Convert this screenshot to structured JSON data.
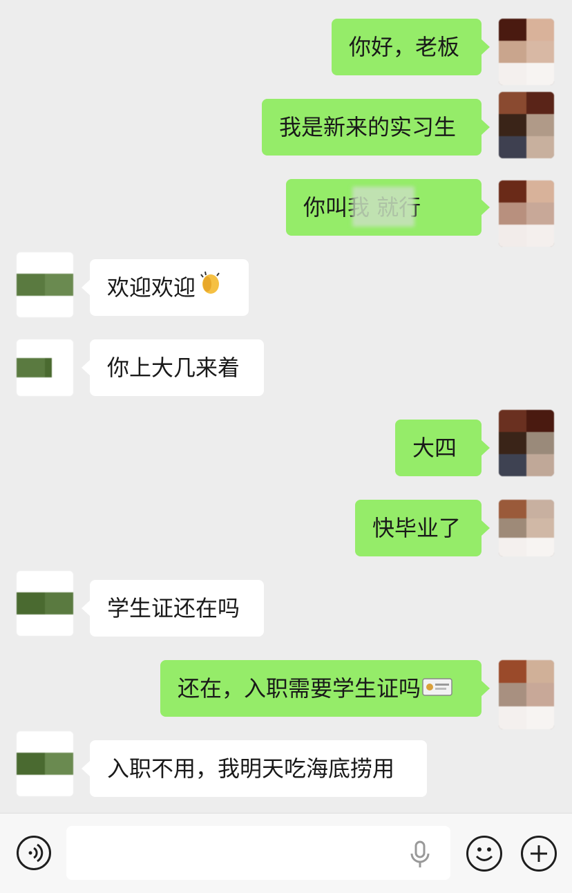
{
  "messages": [
    {
      "side": "mine",
      "text": "你好，老板"
    },
    {
      "side": "mine",
      "text": "我是新来的实习生"
    },
    {
      "side": "mine",
      "text": "你叫我    就行"
    },
    {
      "side": "other",
      "text": "欢迎欢迎",
      "emoji": "clapping-hands-icon"
    },
    {
      "side": "other",
      "text": "你上大几来着"
    },
    {
      "side": "mine",
      "text": "大四"
    },
    {
      "side": "mine",
      "text": "快毕业了"
    },
    {
      "side": "other",
      "text": "学生证还在吗"
    },
    {
      "side": "mine",
      "text": "还在，入职需要学生证吗",
      "emoji": "id-card-icon"
    },
    {
      "side": "other",
      "text": "入职不用，我明天吃海底捞用"
    }
  ],
  "input_bar": {
    "voice_icon": "voice-icon",
    "placeholder": "",
    "mic_icon": "microphone-icon",
    "emoji_icon": "smiley-icon",
    "plus_icon": "plus-icon"
  },
  "colors": {
    "background": "#ededed",
    "my_bubble": "#95ec69",
    "other_bubble": "#ffffff",
    "text": "#191919"
  }
}
